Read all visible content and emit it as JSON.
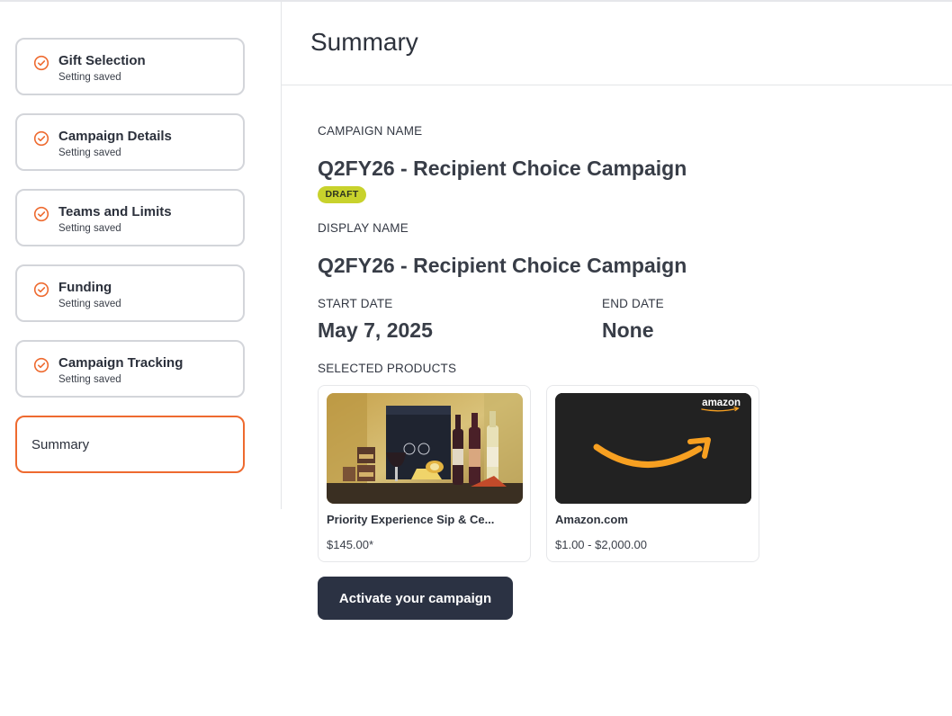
{
  "sidebar": {
    "steps": [
      {
        "title": "Gift Selection",
        "status": "Setting saved"
      },
      {
        "title": "Campaign Details",
        "status": "Setting saved"
      },
      {
        "title": "Teams and Limits",
        "status": "Setting saved"
      },
      {
        "title": "Funding",
        "status": "Setting saved"
      },
      {
        "title": "Campaign Tracking",
        "status": "Setting saved"
      }
    ],
    "active_step": "Summary"
  },
  "main": {
    "title": "Summary",
    "campaign_name_label": "CAMPAIGN NAME",
    "campaign_name": "Q2FY26 - Recipient Choice Campaign",
    "status_badge": "DRAFT",
    "display_name_label": "DISPLAY NAME",
    "display_name": "Q2FY26 - Recipient Choice Campaign",
    "start_date_label": "START DATE",
    "start_date": "May 7, 2025",
    "end_date_label": "END DATE",
    "end_date": "None",
    "selected_products_label": "SELECTED PRODUCTS",
    "products": [
      {
        "name": "Priority Experience Sip & Ce...",
        "price": "$145.00*"
      },
      {
        "name": "Amazon.com",
        "price": "$1.00 - $2,000.00",
        "logo_text": "amazon"
      }
    ],
    "activate_label": "Activate your campaign"
  },
  "colors": {
    "accent": "#ee6a2f",
    "badge": "#c8d22c",
    "button": "#2b3243",
    "amazon_card": "#222222",
    "amazon_smile": "#f7a021"
  },
  "icons": {
    "step_status": "check-circle-icon"
  }
}
